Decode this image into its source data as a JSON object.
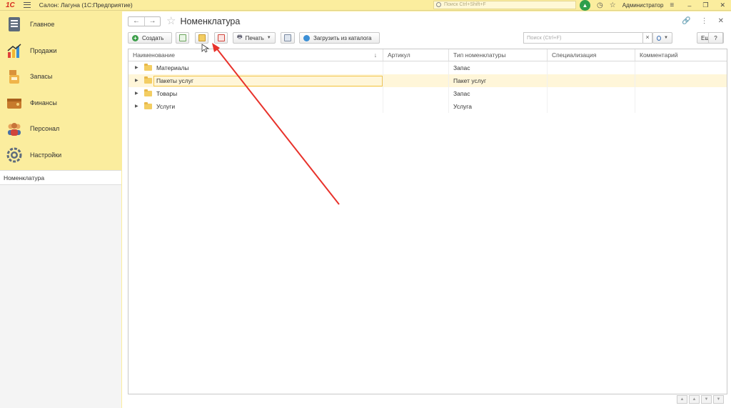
{
  "topbar": {
    "logo": "1С",
    "app_title": "Салон: Лагуна  (1С:Предприятие)",
    "search_placeholder": "Поиск Ctrl+Shift+F",
    "user": "Администратор"
  },
  "sidebar": {
    "items": [
      {
        "label": "Главное",
        "icon": "main-icon"
      },
      {
        "label": "Продажи",
        "icon": "sales-icon"
      },
      {
        "label": "Запасы",
        "icon": "stock-icon"
      },
      {
        "label": "Финансы",
        "icon": "finance-icon"
      },
      {
        "label": "Персонал",
        "icon": "staff-icon"
      },
      {
        "label": "Настройки",
        "icon": "settings-icon"
      }
    ],
    "open_windows": [
      "Номенклатура"
    ]
  },
  "page": {
    "title": "Номенклатура"
  },
  "toolbar": {
    "create_label": "Создать",
    "print_label": "Печать",
    "load_catalog_label": "Загрузить из каталога",
    "search_placeholder": "Поиск (Ctrl+F)",
    "more_label": "Еще",
    "help_label": "?"
  },
  "table": {
    "columns": [
      "Наименование",
      "Артикул",
      "Тип номенклатуры",
      "Специализация",
      "Комментарий"
    ],
    "rows": [
      {
        "name": "Материалы",
        "article": "",
        "type": "Запас",
        "spec": "",
        "comment": ""
      },
      {
        "name": "Пакеты услуг",
        "article": "",
        "type": "Пакет услуг",
        "spec": "",
        "comment": ""
      },
      {
        "name": "Товары",
        "article": "",
        "type": "Запас",
        "spec": "",
        "comment": ""
      },
      {
        "name": "Услуги",
        "article": "",
        "type": "Услуга",
        "spec": "",
        "comment": ""
      }
    ],
    "sort_indicator": "↓"
  },
  "colors": {
    "accent": "#fbed9e",
    "selected_row": "#fff6d9",
    "annotation_arrow": "#e8322b"
  }
}
